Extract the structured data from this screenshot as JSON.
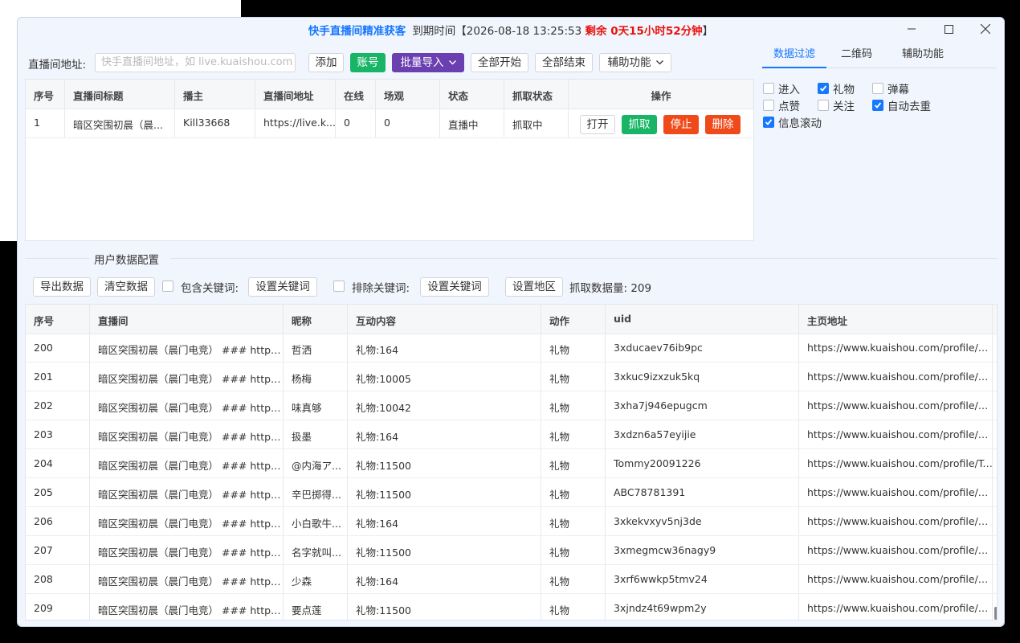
{
  "title": {
    "app_name": "快手直播间精准获客",
    "expiry_label": "到期时间【2026-08-18 13:25:53",
    "remaining": "剩余 0天15小时52分钟",
    "close_bracket": "】"
  },
  "toolbar": {
    "room_url_label": "直播间地址:",
    "room_url_placeholder": "快手直播间地址，如 live.kuaishou.com",
    "add": "添加",
    "account": "账号",
    "batch_import": "批量导入",
    "start_all": "全部开始",
    "stop_all": "全部结束",
    "assist": "辅助功能"
  },
  "right_tabs": [
    "数据过滤",
    "二维码",
    "辅助功能"
  ],
  "filters": [
    {
      "label": "进入",
      "checked": false
    },
    {
      "label": "礼物",
      "checked": true
    },
    {
      "label": "弹幕",
      "checked": false
    },
    {
      "label": "点赞",
      "checked": false
    },
    {
      "label": "关注",
      "checked": false
    },
    {
      "label": "自动去重",
      "checked": true
    },
    {
      "label": "信息滚动",
      "checked": true
    }
  ],
  "rooms_table": {
    "headers": [
      "序号",
      "直播间标题",
      "播主",
      "直播间地址",
      "在线",
      "场观",
      "状态",
      "抓取状态",
      "操作"
    ],
    "rows": [
      {
        "cells": [
          "1",
          "暗区突围初晨（晨...",
          "Kill33668",
          "https://live.k...",
          "0",
          "0",
          "直播中",
          "抓取中"
        ]
      }
    ],
    "actions": [
      "打开",
      "抓取",
      "停止",
      "删除"
    ]
  },
  "config": {
    "section_title": "用户数据配置",
    "export": "导出数据",
    "clear": "清空数据",
    "include_label": "包含关键词:",
    "set_keywords": "设置关键词",
    "exclude_label": "排除关键词:",
    "set_keywords2": "设置关键词",
    "set_region": "设置地区",
    "count_label": "抓取数据量: 209"
  },
  "data_table": {
    "headers": [
      "序号",
      "直播间",
      "昵称",
      "互动内容",
      "动作",
      "uid",
      "主页地址"
    ],
    "rows": [
      [
        "200",
        "暗区突围初晨（晨门电竞） ### https:/...",
        "哲洒",
        "礼物:164",
        "礼物",
        "3xducaev76ib9pc",
        "https://www.kuaishou.com/profile/3xdu..."
      ],
      [
        "201",
        "暗区突围初晨（晨门电竞） ### https:/...",
        "杨梅",
        "礼物:10005",
        "礼物",
        "3xkuc9izxzuk5kq",
        "https://www.kuaishou.com/profile/3xku..."
      ],
      [
        "202",
        "暗区突围初晨（晨门电竞） ### https:/...",
        "味真够",
        "礼物:10042",
        "礼物",
        "3xha7j946epugcm",
        "https://www.kuaishou.com/profile/3xha..."
      ],
      [
        "203",
        "暗区突围初晨（晨门电竞） ### https:/...",
        "扱墨",
        "礼物:164",
        "礼物",
        "3xdzn6a57eyijie",
        "https://www.kuaishou.com/profile/3xdz..."
      ],
      [
        "204",
        "暗区突围初晨（晨门电竞） ### https:/...",
        "@内海ア...",
        "礼物:11500",
        "礼物",
        "Tommy20091226",
        "https://www.kuaishou.com/profile/Tom..."
      ],
      [
        "205",
        "暗区突围初晨（晨门电竞） ### https:/...",
        "辛巴掷得...",
        "礼物:11500",
        "礼物",
        "ABC78781391",
        "https://www.kuaishou.com/profile/ABC..."
      ],
      [
        "206",
        "暗区突围初晨（晨门电竞） ### https:/...",
        "小白歌牛...",
        "礼物:164",
        "礼物",
        "3xkekvxyv5nj3de",
        "https://www.kuaishou.com/profile/3xke..."
      ],
      [
        "207",
        "暗区突围初晨（晨门电竞） ### https:/...",
        "名字就叫...",
        "礼物:11500",
        "礼物",
        "3xmegmcw36nagy9",
        "https://www.kuaishou.com/profile/3xm..."
      ],
      [
        "208",
        "暗区突围初晨（晨门电竞） ### https:/...",
        "少森",
        "礼物:164",
        "礼物",
        "3xrf6wwkp5tmv24",
        "https://www.kuaishou.com/profile/3xrf..."
      ],
      [
        "209",
        "暗区突围初晨（晨门电竞） ### https:/...",
        "要点莲",
        "礼物:11500",
        "礼物",
        "3xjndz4t69wpm2y",
        "https://www.kuaishou.com/profile/3xjn..."
      ]
    ]
  }
}
